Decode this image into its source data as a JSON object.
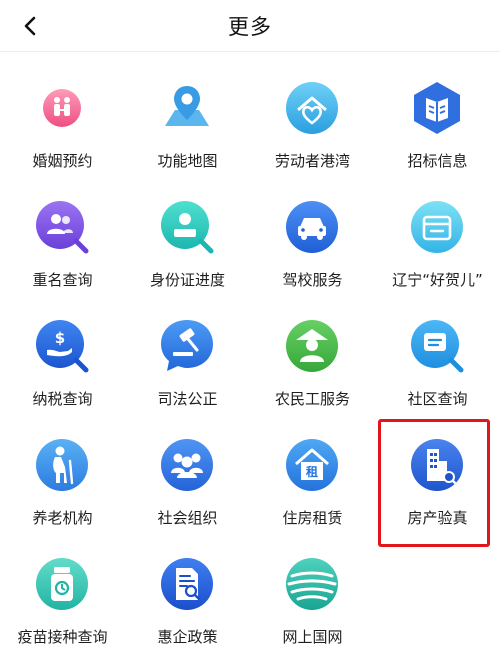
{
  "header": {
    "title": "更多"
  },
  "services": [
    {
      "label": "婚姻预约",
      "icon": "marriage-icon"
    },
    {
      "label": "功能地图",
      "icon": "map-pin-icon"
    },
    {
      "label": "劳动者港湾",
      "icon": "harbor-heart-icon"
    },
    {
      "label": "招标信息",
      "icon": "book-hexagon-icon"
    },
    {
      "label": "重名查询",
      "icon": "people-search-icon"
    },
    {
      "label": "身份证进度",
      "icon": "id-card-search-icon"
    },
    {
      "label": "驾校服务",
      "icon": "car-icon"
    },
    {
      "label": "辽宁“好贺儿”",
      "icon": "folder-icon"
    },
    {
      "label": "纳税查询",
      "icon": "tax-search-icon"
    },
    {
      "label": "司法公正",
      "icon": "gavel-icon"
    },
    {
      "label": "农民工服务",
      "icon": "worker-icon"
    },
    {
      "label": "社区查询",
      "icon": "community-search-icon"
    },
    {
      "label": "养老机构",
      "icon": "elderly-icon"
    },
    {
      "label": "社会组织",
      "icon": "group-icon"
    },
    {
      "label": "住房租赁",
      "icon": "house-rent-icon"
    },
    {
      "label": "房产验真",
      "icon": "building-verify-icon"
    },
    {
      "label": "疫苗接种查询",
      "icon": "vaccine-icon"
    },
    {
      "label": "惠企政策",
      "icon": "policy-doc-icon"
    },
    {
      "label": "网上国网",
      "icon": "grid-globe-icon"
    }
  ],
  "highlight_color": "#e0161c"
}
